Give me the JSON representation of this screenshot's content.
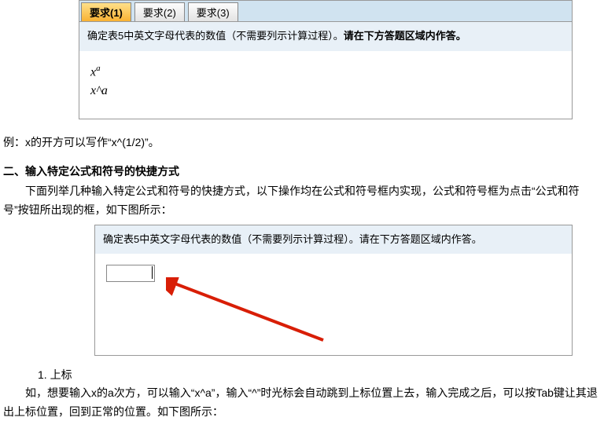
{
  "panel1": {
    "tabs": [
      "要求(1)",
      "要求(2)",
      "要求(3)"
    ],
    "instruction_plain": "确定表5中英文字母代表的数值（不需要列示计算过程）。",
    "instruction_bold": "请在下方答题区域内作答。",
    "formula_rendered_base": "x",
    "formula_rendered_exp": "a",
    "formula_raw": "x^a"
  },
  "example": "例：x的开方可以写作“x^(1/2)”。",
  "section_heading": "二、输入特定公式和符号的快捷方式",
  "section_para": "下面列举几种输入特定公式和符号的快捷方式，以下操作均在公式和符号框内实现，公式和符号框为点击“公式和符号”按钮所出现的框，如下图所示：",
  "panel2": {
    "instruction_plain": "确定表5中英文字母代表的数值（不需要列示计算过程）。",
    "instruction_bold": "请在下方答题区域内作答。"
  },
  "item1_num": "1. 上标",
  "item1_para": "如，想要输入x的a次方，可以输入“x^a”，输入“^”时光标会自动跳到上标位置上去，输入完成之后，可以按Tab键让其退出上标位置，回到正常的位置。如下图所示："
}
